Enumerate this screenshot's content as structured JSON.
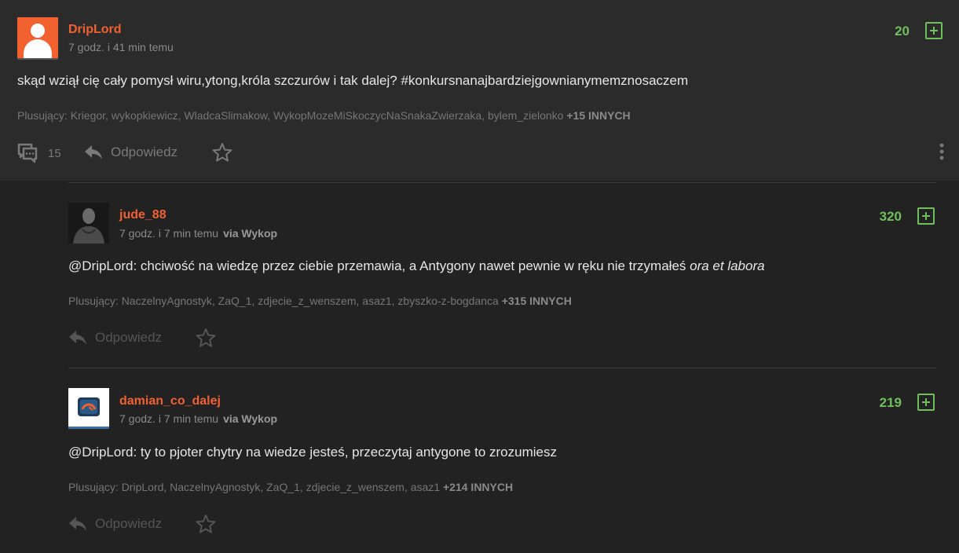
{
  "main_post": {
    "author": "DripLord",
    "time": "7 godz. i 41 min temu",
    "votes": "20",
    "text_plain": "skąd wziął cię cały pomysł wiru,ytong,króla szczurów i tak dalej? ",
    "text_tag": "#konkursnanajbardziejgownianymemznosaczem",
    "voters_label": "Plusujący: Kriegor, wykopkiewicz, WladcaSlimakow, WykopMozeMiSkoczycNaSnakaZwierzaka, bylem_zielonko",
    "voters_more": "+15 INNYCH",
    "comments_count": "15",
    "reply_label": "Odpowiedz"
  },
  "replies": [
    {
      "author": "jude_88",
      "time": "7 godz. i 7 min temu",
      "via": "via Wykop",
      "votes": "320",
      "mention": "@DripLord",
      "text": ": chciwość na wiedzę przez ciebie przemawia, a Antygony nawet pewnie w ręku nie trzymałeś ",
      "text_italic": "ora et labora",
      "voters_label": "Plusujący: NaczelnyAgnostyk, ZaQ_1, zdjecie_z_wenszem, asaz1, zbyszko-z-bogdanca",
      "voters_more": "+315 INNYCH",
      "reply_label": "Odpowiedz"
    },
    {
      "author": "damian_co_dalej",
      "time": "7 godz. i 7 min temu",
      "via": "via Wykop",
      "votes": "219",
      "mention": "@DripLord",
      "text": ": ty to pjoter chytry na wiedze jesteś, przeczytaj antygone to zrozumiesz",
      "voters_label": "Plusujący: DripLord, NaczelnyAgnostyk, ZaQ_1, zdjecie_z_wenszem, asaz1",
      "voters_more": "+214 INNYCH",
      "reply_label": "Odpowiedz"
    }
  ],
  "colors": {
    "accent": "#f26130",
    "vote_green": "#6fbf5a",
    "background": "#222222",
    "post_background": "#2b2b2b"
  },
  "icons": [
    "user-avatar-icon",
    "plus-vote-icon",
    "comments-icon",
    "reply-arrow-icon",
    "star-icon",
    "more-vertical-icon"
  ]
}
